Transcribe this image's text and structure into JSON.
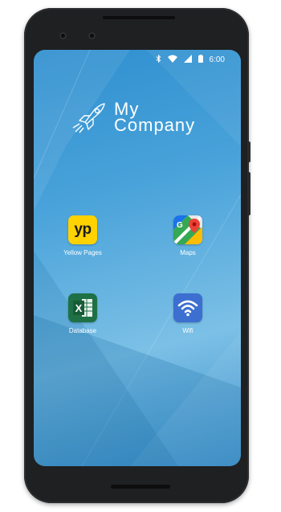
{
  "status_bar": {
    "time": "6:00",
    "icons": [
      "bluetooth-icon",
      "wifi-signal-icon",
      "cell-signal-icon",
      "battery-icon"
    ]
  },
  "logo": {
    "line1": "My",
    "line2": "Company",
    "icon": "rocket-icon"
  },
  "apps": [
    {
      "label": "Yellow Pages",
      "icon": "yellow-pages-icon",
      "icon_text": "yp",
      "color": "#FFD200"
    },
    {
      "label": "Maps",
      "icon": "maps-icon"
    },
    {
      "label": "Database",
      "icon": "excel-icon",
      "icon_text": "X",
      "color": "#1E7145"
    },
    {
      "label": "Wifi",
      "icon": "wifi-icon",
      "color": "#3c6fd0"
    }
  ],
  "colors": {
    "device": "#1f2022",
    "wallpaper_top": "#2f8fcf",
    "wallpaper_bottom": "#3c91cc"
  }
}
